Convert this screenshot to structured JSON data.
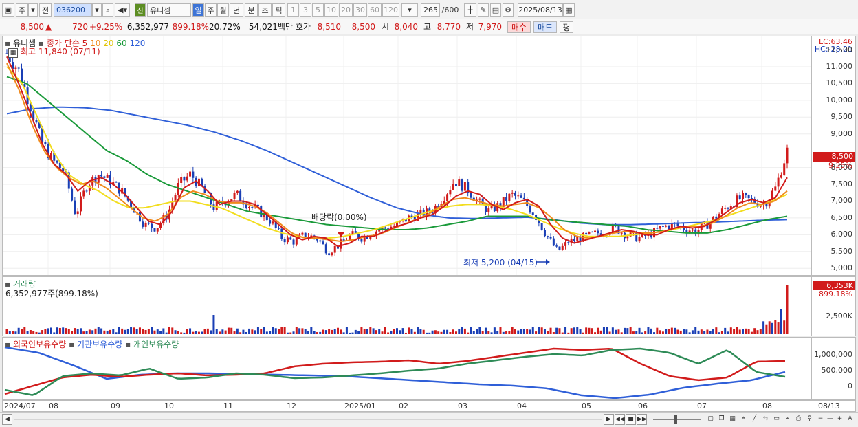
{
  "toolbar": {
    "period_main": "주",
    "prev_label": "전",
    "code": "036200",
    "badge": "신",
    "stock_name": "유니셈",
    "periods": [
      "일",
      "주",
      "월",
      "년",
      "분",
      "초",
      "틱"
    ],
    "intervals": [
      "1",
      "3",
      "5",
      "10",
      "20",
      "30",
      "60",
      "120"
    ],
    "count": "265",
    "count_max": "/600",
    "date": "2025/08/13"
  },
  "quote": {
    "price": "8,500",
    "arrow": "▲",
    "change": "720",
    "change_pct": "+9.25%",
    "volume": "6,352,977",
    "vol_ratio": "899.18%",
    "turnover": "20.72%",
    "amount": "54,021백만",
    "bid_label": "호가",
    "bid": "8,510",
    "ask": "8,500",
    "open_label": "시",
    "open": "8,040",
    "high_label": "고",
    "high": "8,770",
    "low_label": "저",
    "low": "7,970",
    "buy_label": "매수",
    "sell_label": "매도",
    "eval_label": "평"
  },
  "price_panel": {
    "legend_name": "유니셈",
    "legend_ma_title": "종가 단순 5",
    "legend_ma10": "10",
    "legend_ma20": "20",
    "legend_ma60": "60",
    "legend_ma120": "120",
    "high_note": "최고 11,840 (07/11)",
    "low_note": "최저 5,200 (04/15)",
    "dividend_note": "배당락(0.00%)",
    "lc": "LC:63.46",
    "hc": "HC:-28.21",
    "price_tag": "8,500",
    "pct_tag": "9.25%",
    "colors": {
      "up": "#d11b1b",
      "down": "#1a3fb5",
      "ma5": "#d11b1b",
      "ma10": "#f08a1c",
      "ma20": "#f2dd1e",
      "ma60": "#1a9a3a",
      "ma120": "#2f5fd8"
    }
  },
  "volume_panel": {
    "title": "거래량",
    "value": "6,352,977주(899.18%)",
    "tag_value": "6,353K",
    "tag_pct": "899.18%",
    "axis_label": "2,500K"
  },
  "holding_panel": {
    "legend_foreign": "외국인보유수량",
    "legend_inst": "기관보유수량",
    "legend_indiv": "개인보유수량",
    "axis_labels": [
      "1,000,000",
      "500,000",
      "0"
    ],
    "colors": {
      "foreign": "#d11b1b",
      "inst": "#2f5fd8",
      "indiv": "#2e8b57"
    }
  },
  "price_axis_labels": [
    "11,500",
    "11,000",
    "10,500",
    "10,000",
    "9,500",
    "9,000",
    "8,000",
    "7,500",
    "7,000",
    "6,500",
    "6,000",
    "5,500",
    "5,000"
  ],
  "date_labels": [
    "2024/07",
    "08",
    "09",
    "10",
    "11",
    "12",
    "2025/01",
    "02",
    "03",
    "04",
    "05",
    "06",
    "07",
    "08",
    "08/13"
  ],
  "chart_data": {
    "type": "candlestick",
    "ylim": [
      4800,
      11900
    ],
    "months": [
      "2024/07",
      "08",
      "09",
      "10",
      "11",
      "12",
      "2025/01",
      "02",
      "03",
      "04",
      "05",
      "06",
      "07",
      "08"
    ],
    "close_path": [
      11400,
      10900,
      9900,
      8800,
      8200,
      7900,
      6600,
      7500,
      7800,
      7600,
      7300,
      6800,
      6300,
      6200,
      6600,
      7500,
      7800,
      7400,
      6800,
      7000,
      7200,
      6900,
      6700,
      6400,
      5900,
      5800,
      6000,
      5900,
      5500,
      5700,
      6000,
      5900,
      6100,
      6200,
      6300,
      6500,
      6600,
      6700,
      7100,
      7600,
      7400,
      7000,
      6700,
      6900,
      7200,
      7000,
      6600,
      6000,
      5500,
      5800,
      5900,
      6000,
      6100,
      6200,
      6000,
      5900,
      6000,
      6200,
      6300,
      6200,
      6100,
      6300,
      6600,
      6900,
      7100,
      7000,
      6900,
      7400,
      8500
    ],
    "ma5": [
      11300,
      10500,
      9600,
      8700,
      8100,
      7800,
      7300,
      7600,
      7700,
      7500,
      7200,
      6800,
      6400,
      6300,
      6700,
      7400,
      7600,
      7300,
      6900,
      7000,
      7000,
      6900,
      6600,
      6300,
      6000,
      5850,
      5950,
      5900,
      5650,
      5750,
      5950,
      5950,
      6100,
      6250,
      6350,
      6500,
      6600,
      6850,
      7150,
      7300,
      7200,
      6900,
      6750,
      6950,
      7050,
      6850,
      6300,
      5900,
      5750,
      5850,
      5950,
      6050,
      6150,
      6100,
      6000,
      6000,
      6150,
      6250,
      6200,
      6250,
      6450,
      6700,
      6950,
      7050,
      6950,
      7100,
      7700
    ],
    "ma10": [
      11100,
      10300,
      9300,
      8500,
      8000,
      7700,
      7500,
      7600,
      7400,
      7100,
      6800,
      6500,
      6400,
      6600,
      7100,
      7300,
      7200,
      7000,
      6950,
      6950,
      6850,
      6650,
      6350,
      6050,
      5900,
      5900,
      5850,
      5800,
      5850,
      5950,
      6000,
      6150,
      6300,
      6450,
      6600,
      6850,
      7050,
      7100,
      7000,
      6900,
      6850,
      6900,
      6950,
      6800,
      6500,
      6150,
      5950,
      5900,
      5950,
      6050,
      6100,
      6050,
      6050,
      6100,
      6200,
      6250,
      6250,
      6350,
      6550,
      6800,
      6950,
      6900,
      7000,
      7300
    ],
    "ma20": [
      11000,
      10500,
      9500,
      8500,
      7800,
      7500,
      7300,
      7000,
      6800,
      6800,
      6900,
      7000,
      7000,
      6900,
      6800,
      6600,
      6400,
      6200,
      6050,
      5950,
      5900,
      5900,
      5950,
      6050,
      6150,
      6300,
      6450,
      6600,
      6750,
      6850,
      6900,
      6900,
      6850,
      6750,
      6600,
      6400,
      6200,
      6050,
      5950,
      5950,
      5950,
      6000,
      6050,
      6100,
      6200,
      6300,
      6400,
      6550,
      6700,
      6850,
      7000,
      7200
    ],
    "ma60": [
      10700,
      10500,
      10000,
      9500,
      9000,
      8500,
      8200,
      7800,
      7500,
      7300,
      7100,
      6900,
      6700,
      6600,
      6500,
      6400,
      6300,
      6250,
      6200,
      6150,
      6150,
      6200,
      6300,
      6400,
      6550,
      6550,
      6550,
      6450,
      6400,
      6350,
      6300,
      6250,
      6150,
      6100,
      6050,
      6050,
      6150,
      6300,
      6450,
      6550
    ],
    "ma120": [
      9600,
      9750,
      9800,
      9780,
      9700,
      9550,
      9400,
      9250,
      9050,
      8800,
      8500,
      8150,
      7800,
      7450,
      7100,
      6800,
      6600,
      6500,
      6480,
      6500,
      6520,
      6450,
      6350,
      6300,
      6300,
      6320,
      6350,
      6370,
      6400,
      6430,
      6450
    ],
    "volume": {
      "last": 6352977,
      "last_ratio_pct": 899.18,
      "axis_tick": 2500000
    },
    "holdings": {
      "axis_ticks": [
        1000000,
        500000,
        0
      ]
    }
  }
}
